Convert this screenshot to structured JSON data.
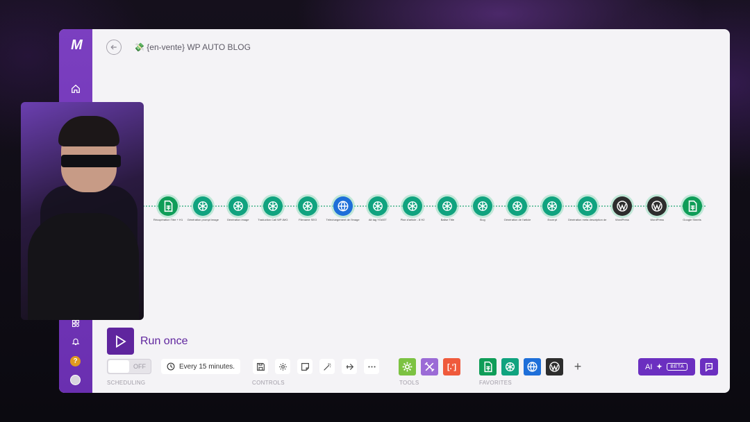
{
  "scenario": {
    "title": "💸 {en-vente} WP AUTO BLOG"
  },
  "flow": {
    "nodes": [
      {
        "label": "Récupération Titre + H1",
        "icon": "google-sheets-icon",
        "color": "#0f9d58"
      },
      {
        "label": "Génération prompt image",
        "icon": "openai-icon",
        "color": "#10a37f"
      },
      {
        "label": "Génération image",
        "icon": "openai-icon",
        "color": "#10a37f"
      },
      {
        "label": "Traduction Call WP-IMG",
        "icon": "openai-icon",
        "color": "#10a37f"
      },
      {
        "label": "Filename SEO",
        "icon": "openai-icon",
        "color": "#10a37f"
      },
      {
        "label": "Téléchargement de l'image",
        "icon": "http-globe-icon",
        "color": "#1e6fd9"
      },
      {
        "label": "Alt tag YOAST",
        "icon": "openai-icon",
        "color": "#10a37f"
      },
      {
        "label": "Plan d'article - 8 H2",
        "icon": "openai-icon",
        "color": "#10a37f"
      },
      {
        "label": "Balise Title",
        "icon": "openai-icon",
        "color": "#10a37f"
      },
      {
        "label": "Slug",
        "icon": "openai-icon",
        "color": "#10a37f"
      },
      {
        "label": "Génération de l'article",
        "icon": "openai-icon",
        "color": "#10a37f"
      },
      {
        "label": "Excerpt",
        "icon": "openai-icon",
        "color": "#10a37f"
      },
      {
        "label": "Génération meta description de l'article",
        "icon": "openai-icon",
        "color": "#10a37f"
      },
      {
        "label": "WordPress",
        "icon": "wordpress-icon",
        "color": "#2d2d2d"
      },
      {
        "label": "WordPress",
        "icon": "wordpress-icon",
        "color": "#2d2d2d"
      },
      {
        "label": "Google Sheets",
        "icon": "google-sheets-icon",
        "color": "#0f9d58"
      }
    ]
  },
  "run": {
    "label": "Run once"
  },
  "scheduling": {
    "toggle_state": "OFF",
    "interval": "Every 15 minutes.",
    "section_label": "SCHEDULING"
  },
  "controls": {
    "section_label": "CONTROLS"
  },
  "tools": {
    "section_label": "TOOLS",
    "text_parser_label": "[.']"
  },
  "favorites": {
    "section_label": "FAVORITES"
  },
  "ai": {
    "label": "AI",
    "badge": "BETA"
  },
  "colors": {
    "brand_purple": "#6b2fc0",
    "sidebar_purple": "#7b3fc0",
    "openai_green": "#10a37f",
    "sheets_green": "#0f9d58",
    "http_blue": "#1e6fd9",
    "wordpress_dark": "#2d2d2d",
    "tools_green": "#7cc242",
    "tools_purple": "#9b6bd6",
    "tools_red": "#ef5a3c"
  }
}
